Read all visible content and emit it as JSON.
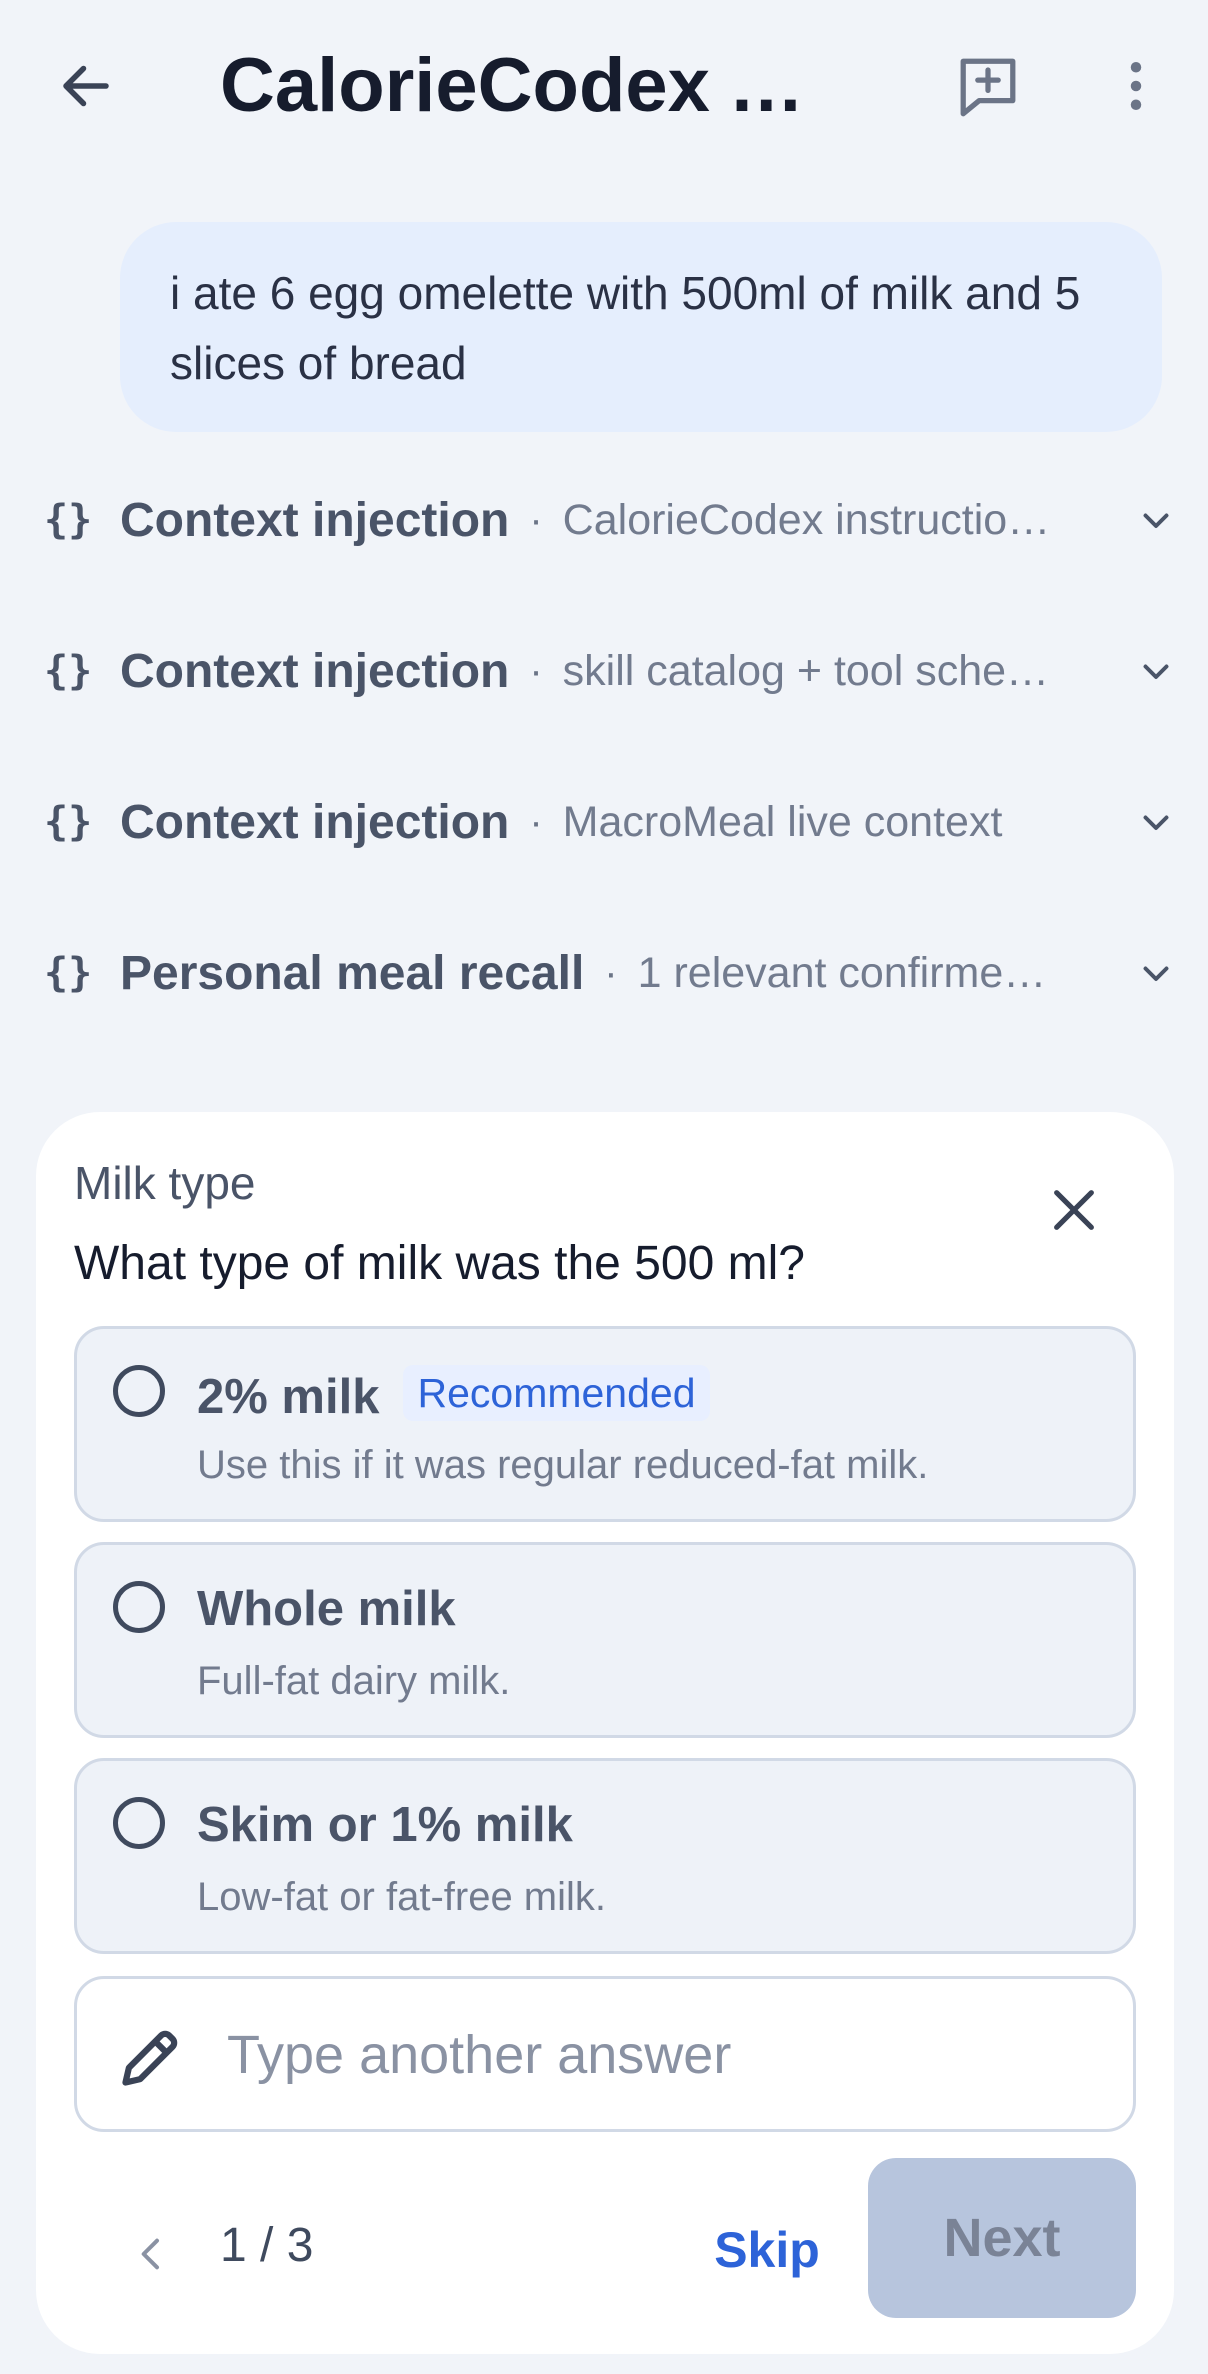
{
  "header": {
    "title": "CalorieCodex A…",
    "back_icon": "arrow-left-icon",
    "new_chat_icon": "new-chat-icon",
    "more_icon": "more-vertical-icon"
  },
  "user_message": "i ate 6 egg omelette with 500ml of milk and 5 slices of bread",
  "context_rows": [
    {
      "icon": "{}",
      "title": "Context injection",
      "subtitle": "CalorieCodex instructio…"
    },
    {
      "icon": "{}",
      "title": "Context injection",
      "subtitle": "skill catalog + tool sche…"
    },
    {
      "icon": "{}",
      "title": "Context injection",
      "subtitle": "MacroMeal live context"
    },
    {
      "icon": "{}",
      "title": "Personal meal recall",
      "subtitle": "1 relevant confirme…"
    }
  ],
  "separator": "·",
  "question_card": {
    "eyebrow": "Milk type",
    "question": "What type of milk was the 500 ml?",
    "options": [
      {
        "title": "2% milk",
        "badge": "Recommended",
        "description": "Use this if it was regular reduced-fat milk."
      },
      {
        "title": "Whole milk",
        "description": "Full-fat dairy milk."
      },
      {
        "title": "Skim or 1% milk",
        "description": "Low-fat or fat-free milk."
      }
    ],
    "answer_placeholder": "Type another answer",
    "answer_value": "",
    "pager": "1 / 3",
    "skip_label": "Skip",
    "next_label": "Next"
  },
  "colors": {
    "background": "#f1f4f9",
    "bubble": "#e5eefd",
    "accent": "#2d63d8",
    "next_disabled": "#b7c5dd"
  }
}
